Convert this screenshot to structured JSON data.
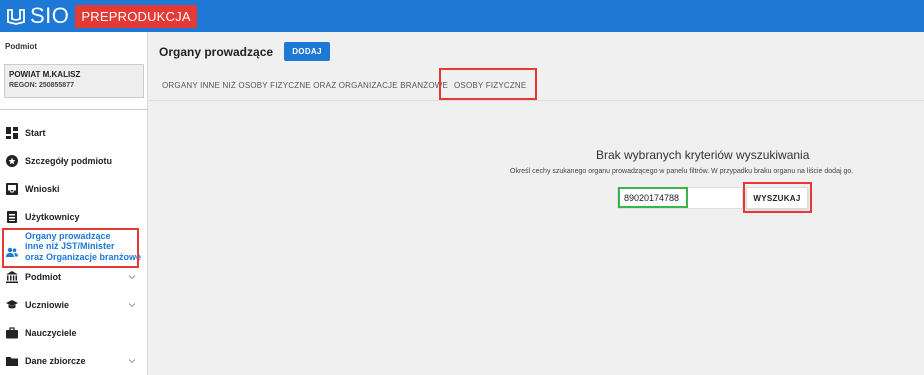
{
  "header": {
    "logo_text": "SIO",
    "env_badge": "PREPRODUKCJA"
  },
  "sidebar": {
    "section_label": "Podmiot",
    "entity_name": "POWIAT M.KALISZ",
    "entity_regon": "REGON: 250855877",
    "items": [
      {
        "label": "Start",
        "icon": "dashboard-icon"
      },
      {
        "label": "Szczegóły podmiotu",
        "icon": "badge-icon"
      },
      {
        "label": "Wnioski",
        "icon": "inbox-icon"
      },
      {
        "label": "Użytkownicy",
        "icon": "badge-card-icon"
      },
      {
        "label_line1": "Organy prowadzące",
        "label_line2": "inne niż JST/Minister",
        "label_line3": "oraz Organizacje branżowe",
        "icon": "people-icon",
        "active": true
      },
      {
        "label": "Podmiot",
        "icon": "bank-icon",
        "chevron": true
      },
      {
        "label": "Uczniowie",
        "icon": "graduation-cap-icon",
        "chevron": true
      },
      {
        "label": "Nauczyciele",
        "icon": "briefcase-icon"
      },
      {
        "label": "Dane zbiorcze",
        "icon": "folder-icon",
        "chevron": true
      }
    ]
  },
  "main": {
    "title": "Organy prowadzące",
    "add_button": "DODAJ",
    "tabs": [
      {
        "label": "ORGANY INNE NIŻ OSOBY FIZYCZNE ORAZ ORGANIZACJE BRANŻOWE"
      },
      {
        "label": "OSOBY FIZYCZNE"
      }
    ],
    "empty_title": "Brak wybranych kryteriów wyszukiwania",
    "empty_desc": "Określ cechy szukanego organu prowadzącego w panelu filtrów. W przypadku braku organu na liście dodaj go.",
    "search_value": "89020174788",
    "search_button": "WYSZUKAJ"
  },
  "colors": {
    "primary": "#1e78d6",
    "badge": "#e53935",
    "highlight_red": "#e53935",
    "highlight_green": "#3bb54a"
  }
}
